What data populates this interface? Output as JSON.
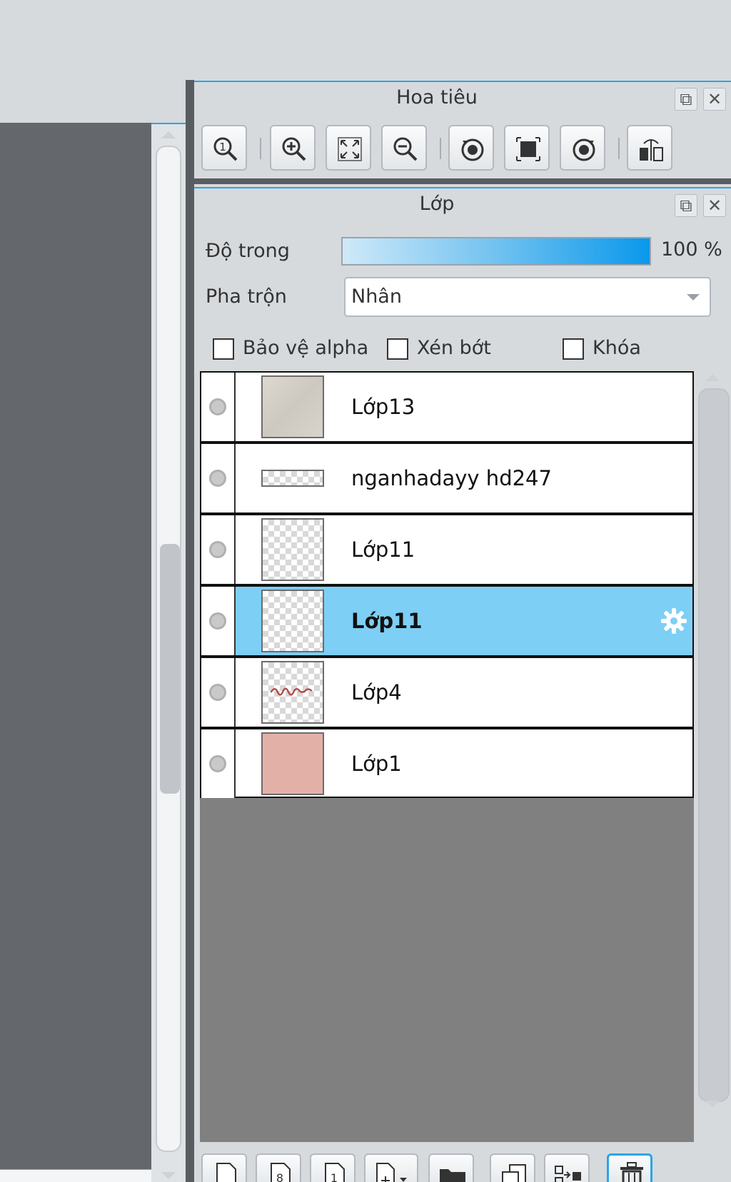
{
  "navigator": {
    "title": "Hoa tiêu",
    "tools": [
      {
        "name": "zoom-100-icon"
      },
      {
        "name": "zoom-in-icon"
      },
      {
        "name": "fit-screen-icon"
      },
      {
        "name": "zoom-out-icon"
      },
      {
        "name": "rotate-left-icon"
      },
      {
        "name": "reset-rotation-icon"
      },
      {
        "name": "rotate-right-icon"
      },
      {
        "name": "flip-horizontal-icon"
      }
    ]
  },
  "layers": {
    "title": "Lớp",
    "opacity_label": "Độ trong",
    "opacity_value": "100 %",
    "opacity_fraction": 1.0,
    "blend_label": "Pha trộn",
    "blend_value": "Nhân",
    "checkboxes": {
      "protect_alpha": "Bảo vệ alpha",
      "clipping": "Xén bớt",
      "lock": "Khóa"
    },
    "items": [
      {
        "name": "Lớp13",
        "thumb": "texture",
        "selected": false
      },
      {
        "name": "nganhadayy hd247",
        "thumb": "text-strip",
        "selected": false
      },
      {
        "name": "Lớp11",
        "thumb": "transparent",
        "selected": false
      },
      {
        "name": "Lớp11",
        "thumb": "transparent",
        "selected": true
      },
      {
        "name": "Lớp4",
        "thumb": "sketch",
        "selected": false
      },
      {
        "name": "Lớp1",
        "thumb": "pink-fill",
        "selected": false
      }
    ],
    "bottom_tools": [
      {
        "name": "new-layer-icon"
      },
      {
        "name": "new-8bit-layer-icon"
      },
      {
        "name": "new-1bit-layer-icon"
      },
      {
        "name": "add-layer-menu-icon"
      },
      {
        "name": "new-folder-icon"
      },
      {
        "name": "duplicate-layer-icon"
      },
      {
        "name": "merge-down-icon"
      },
      {
        "name": "delete-layer-icon"
      }
    ],
    "colors": {
      "selected_row": "#7ecff5",
      "accent": "#2aa5e8",
      "pink_fill": "#e3b0a8"
    }
  }
}
